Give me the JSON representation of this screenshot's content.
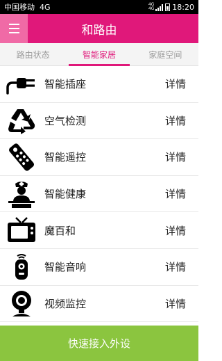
{
  "status_bar": {
    "carrier": "中国移动",
    "network": "4G",
    "network_small_1": "4G",
    "network_small_2": "4G",
    "time": "18:20"
  },
  "header": {
    "title": "和路由",
    "menu_icon": "menu-icon"
  },
  "tabs": [
    {
      "label": "路由状态",
      "active": false
    },
    {
      "label": "智能家居",
      "active": true
    },
    {
      "label": "家庭空间",
      "active": false
    }
  ],
  "devices": [
    {
      "label": "智能插座",
      "detail": "详情",
      "icon": "plug-icon"
    },
    {
      "label": "空气检测",
      "detail": "详情",
      "icon": "recycle-icon"
    },
    {
      "label": "智能遥控",
      "detail": "详情",
      "icon": "remote-icon"
    },
    {
      "label": "智能健康",
      "detail": "详情",
      "icon": "nurse-icon"
    },
    {
      "label": "魔百和",
      "detail": "详情",
      "icon": "tv-icon"
    },
    {
      "label": "智能音响",
      "detail": "详情",
      "icon": "speaker-icon"
    },
    {
      "label": "视频监控",
      "detail": "详情",
      "icon": "webcam-icon"
    }
  ],
  "bottom_button": {
    "label": "快速接入外设"
  },
  "colors": {
    "accent": "#e0187a",
    "menu_bg": "#f06aa6",
    "button_green": "#8bc53f"
  }
}
